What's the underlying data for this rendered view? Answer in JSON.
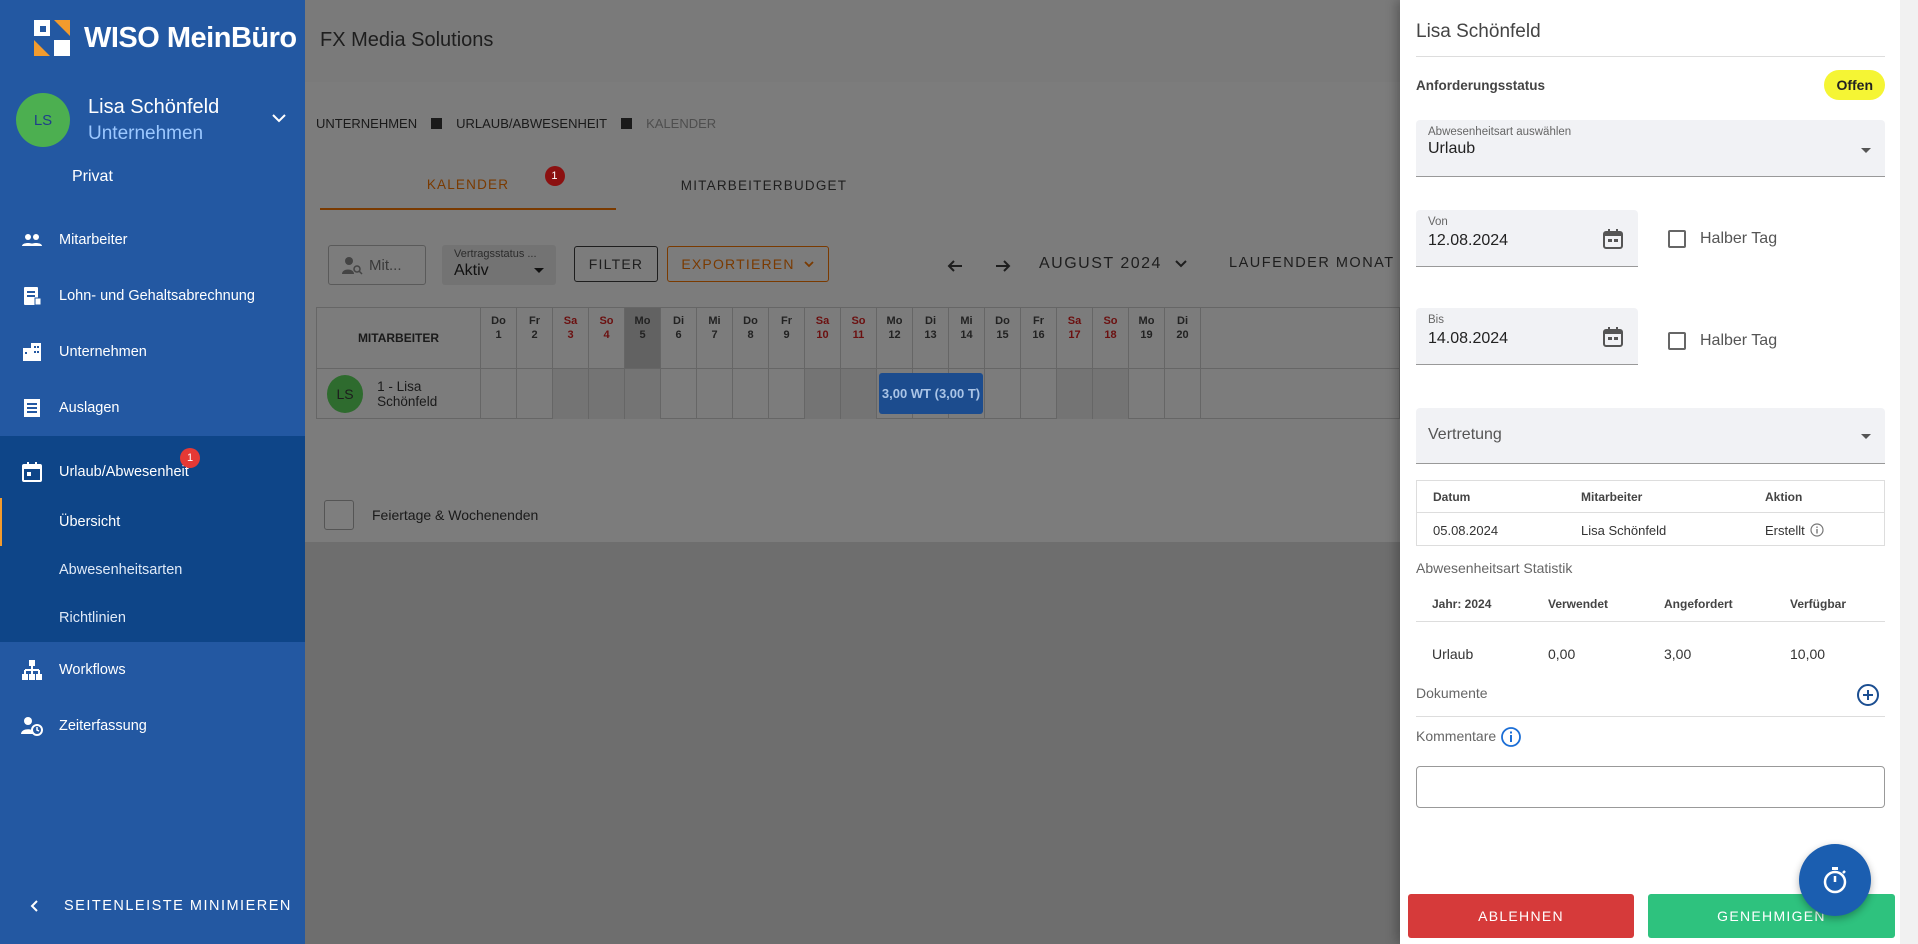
{
  "sidebar": {
    "logo_text": "WISO MeinBüro",
    "user": {
      "initials": "LS",
      "name": "Lisa Schönfeld",
      "company": "Unternehmen"
    },
    "privat_label": "Privat",
    "nav": [
      {
        "label": "Mitarbeiter",
        "icon": "people-icon"
      },
      {
        "label": "Lohn- und Gehaltsabrechnung",
        "icon": "payroll-icon"
      },
      {
        "label": "Unternehmen",
        "icon": "building-icon"
      },
      {
        "label": "Auslagen",
        "icon": "receipt-icon"
      }
    ],
    "absence": {
      "label": "Urlaub/Abwesenheit",
      "badge": "1",
      "sub": [
        "Übersicht",
        "Abwesenheitsarten",
        "Richtlinien"
      ]
    },
    "nav_bottom": [
      {
        "label": "Workflows",
        "icon": "workflow-icon"
      },
      {
        "label": "Zeiterfassung",
        "icon": "time-tracking-icon"
      }
    ],
    "minimize_label": "SEITENLEISTE MINIMIEREN"
  },
  "main": {
    "company": "FX Media Solutions",
    "breadcrumb": [
      "UNTERNEHMEN",
      "URLAUB/ABWESENHEIT",
      "KALENDER"
    ],
    "tabs": [
      {
        "label": "KALENDER",
        "badge": "1"
      },
      {
        "label": "MITARBEITERBUDGET"
      }
    ],
    "search_placeholder": "Mit...",
    "contract_status": {
      "label": "Vertragsstatus ...",
      "value": "Aktiv"
    },
    "filter_label": "FILTER",
    "export_label": "EXPORTIEREN",
    "month_label": "AUGUST 2024",
    "current_month_label": "LAUFENDER MONAT",
    "calendar": {
      "employee_header": "MITARBEITER",
      "days": [
        {
          "wd": "Do",
          "d": "1"
        },
        {
          "wd": "Fr",
          "d": "2"
        },
        {
          "wd": "Sa",
          "d": "3"
        },
        {
          "wd": "So",
          "d": "4"
        },
        {
          "wd": "Mo",
          "d": "5"
        },
        {
          "wd": "Di",
          "d": "6"
        },
        {
          "wd": "Mi",
          "d": "7"
        },
        {
          "wd": "Do",
          "d": "8"
        },
        {
          "wd": "Fr",
          "d": "9"
        },
        {
          "wd": "Sa",
          "d": "10"
        },
        {
          "wd": "So",
          "d": "11"
        },
        {
          "wd": "Mo",
          "d": "12"
        },
        {
          "wd": "Di",
          "d": "13"
        },
        {
          "wd": "Mi",
          "d": "14"
        },
        {
          "wd": "Do",
          "d": "15"
        },
        {
          "wd": "Fr",
          "d": "16"
        },
        {
          "wd": "Sa",
          "d": "17"
        },
        {
          "wd": "So",
          "d": "18"
        },
        {
          "wd": "Mo",
          "d": "19"
        },
        {
          "wd": "Di",
          "d": "20"
        }
      ],
      "row": {
        "initials": "LS",
        "name": "1 - Lisa Schönfeld",
        "event": "3,00 WT (3,00 T)"
      }
    },
    "holidays_label": "Feiertage & Wochenenden"
  },
  "panel": {
    "title": "Lisa Schönfeld",
    "status_label": "Anforderungsstatus",
    "status_value": "Offen",
    "absence_type": {
      "label": "Abwesenheitsart auswählen",
      "value": "Urlaub"
    },
    "from": {
      "label": "Von",
      "value": "12.08.2024"
    },
    "to": {
      "label": "Bis",
      "value": "14.08.2024"
    },
    "half_day_label": "Halber Tag",
    "substitute_label": "Vertretung",
    "history": {
      "headers": [
        "Datum",
        "Mitarbeiter",
        "Aktion"
      ],
      "row": [
        "05.08.2024",
        "Lisa Schönfeld",
        "Erstellt"
      ]
    },
    "stats_title": "Abwesenheitsart Statistik",
    "stats": {
      "headers": [
        "Jahr: 2024",
        "Verwendet",
        "Angefordert",
        "Verfügbar"
      ],
      "row": [
        "Urlaub",
        "0,00",
        "3,00",
        "10,00"
      ]
    },
    "documents_label": "Dokumente",
    "comments_label": "Kommentare",
    "reject_label": "ABLEHNEN",
    "approve_label": "GENEHMIGEN"
  },
  "colors": {
    "sidebar": "#2358a2",
    "approve": "#2ec27e",
    "reject": "#d63a3a",
    "status": "#f5f534",
    "accent": "#f39b2d"
  }
}
